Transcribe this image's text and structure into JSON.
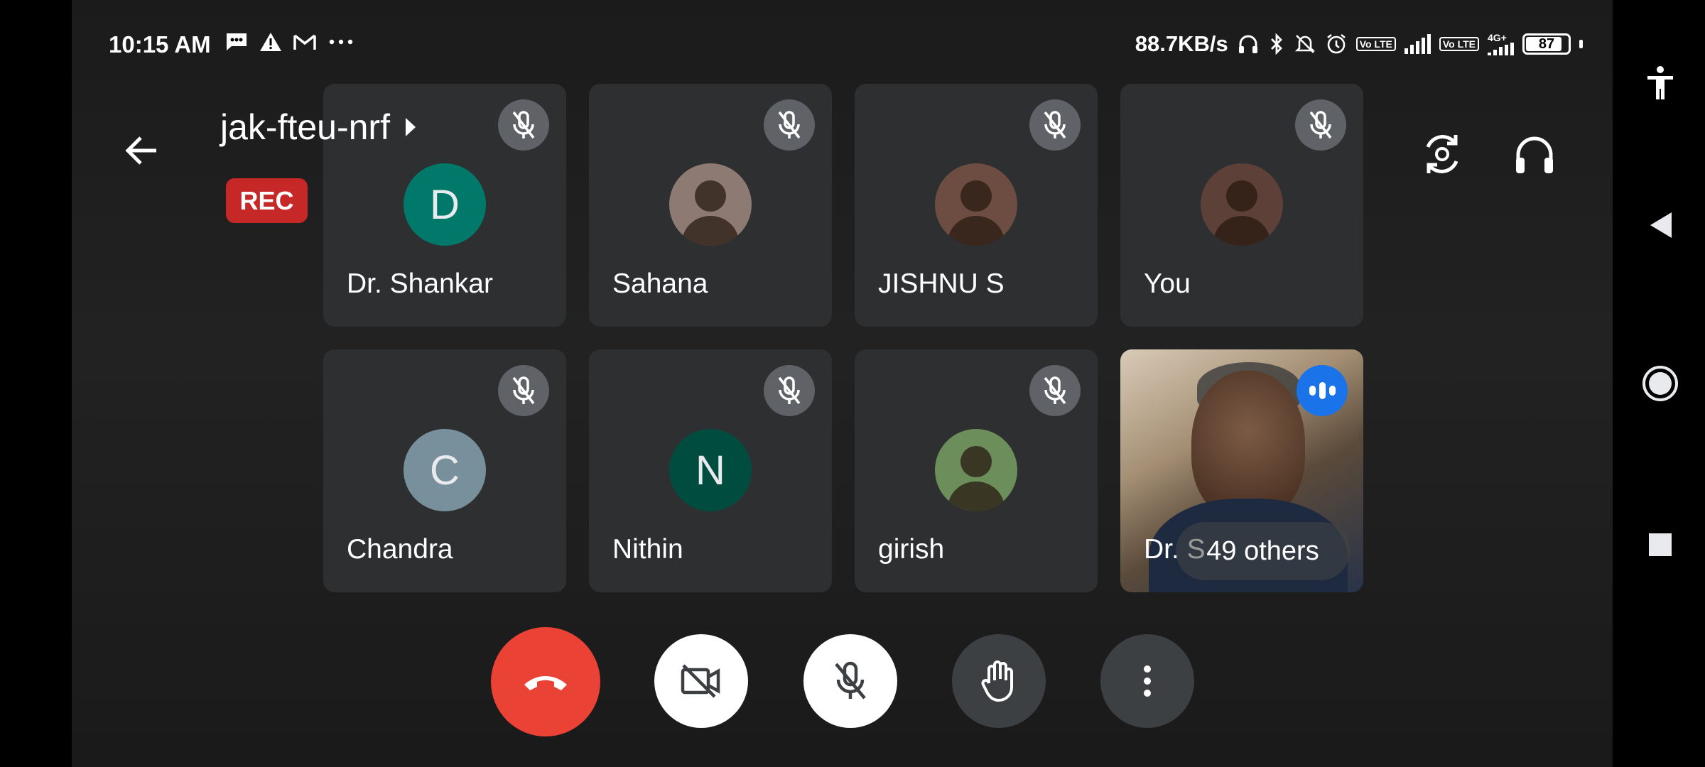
{
  "status_bar": {
    "time": "10:15 AM",
    "notification_icons": [
      "message-icon",
      "warning-icon",
      "gmail-icon",
      "more-dots-icon"
    ],
    "net_speed": "88.7KB/s",
    "system_icons": [
      "headset-icon",
      "bluetooth-icon",
      "silent-icon",
      "alarm-icon",
      "volte-icon",
      "signal-icon",
      "volte-icon",
      "4g-signal-icon"
    ],
    "lte_label": "Vo LTE",
    "network_label": "4G+",
    "battery": "87",
    "battery_fraction": 0.87
  },
  "header": {
    "meeting_code": "jak-fteu-nrf",
    "rec_label": "REC"
  },
  "participants": [
    {
      "name": "Dr. Shankar",
      "initial": "D",
      "avatar_color": "#00796b",
      "muted": true
    },
    {
      "name": "Sahana",
      "initial": "",
      "avatar_color": "#8d7b73",
      "muted": true
    },
    {
      "name": "JISHNU S",
      "initial": "",
      "avatar_color": "#6d4c41",
      "muted": true
    },
    {
      "name": "You",
      "initial": "",
      "avatar_color": "#5d4037",
      "muted": true
    },
    {
      "name": "Chandra",
      "initial": "C",
      "avatar_color": "#78909c",
      "muted": true
    },
    {
      "name": "Nithin",
      "initial": "N",
      "avatar_color": "#004d40",
      "muted": true
    },
    {
      "name": "girish",
      "initial": "",
      "avatar_color": "#6b8e5a",
      "muted": true
    },
    {
      "name": "Dr. S",
      "initial": "",
      "avatar_color": "",
      "muted": false,
      "speaking": true
    }
  ],
  "others_label": "49 others",
  "controls": {
    "end_call": "end-call-icon",
    "camera": "camera-off-icon",
    "mic": "mic-off-icon",
    "hand": "raise-hand-icon",
    "more": "more-vert-icon"
  },
  "colors": {
    "end_call": "#ea4335",
    "rec": "#c62828",
    "speaking": "#1a73e8",
    "tile": "#2e2f31"
  }
}
